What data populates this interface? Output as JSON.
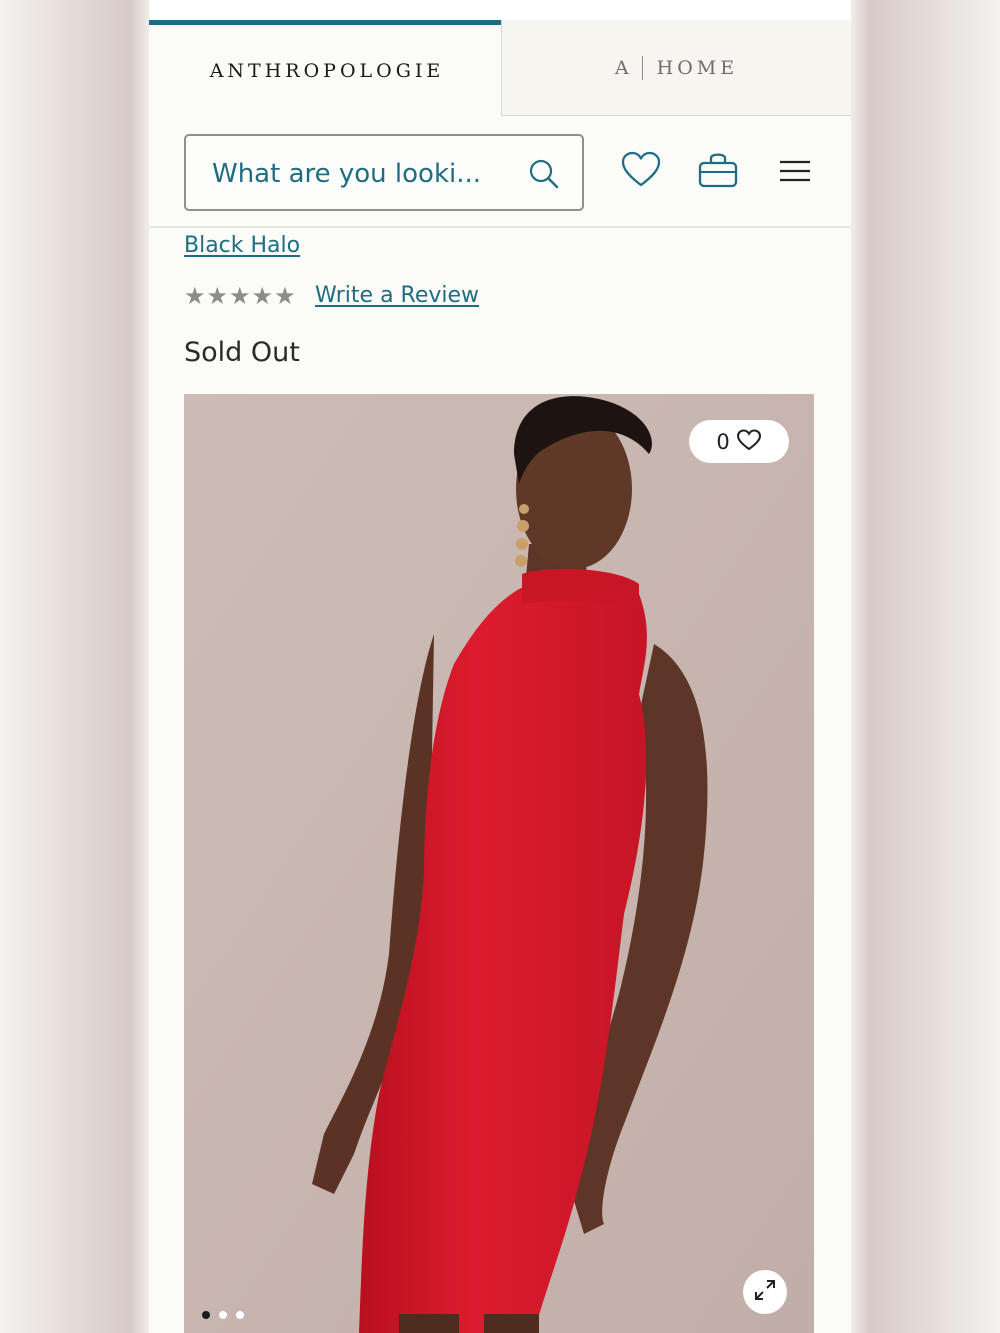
{
  "header": {
    "tabs": [
      {
        "label": "ANTHROPOLOGIE",
        "active": true
      },
      {
        "label_a": "A",
        "label_home": "HOME",
        "active": false
      }
    ]
  },
  "search": {
    "placeholder": "What are you looki...",
    "icon": "search-icon"
  },
  "toolbar": {
    "icons": [
      "heart-icon",
      "shopping-bag-icon",
      "menu-icon"
    ]
  },
  "product": {
    "brand": "Black Halo",
    "rating_stars": "★★★★★",
    "rating_value": 0,
    "review_link": "Write a Review",
    "status": "Sold Out",
    "favorites_count": "0",
    "image_dots": {
      "total": 3,
      "active_index": 0
    }
  },
  "colors": {
    "accent": "#1e6d83",
    "dress": "#d81a2c",
    "photo_background": "#cdbcb6"
  }
}
